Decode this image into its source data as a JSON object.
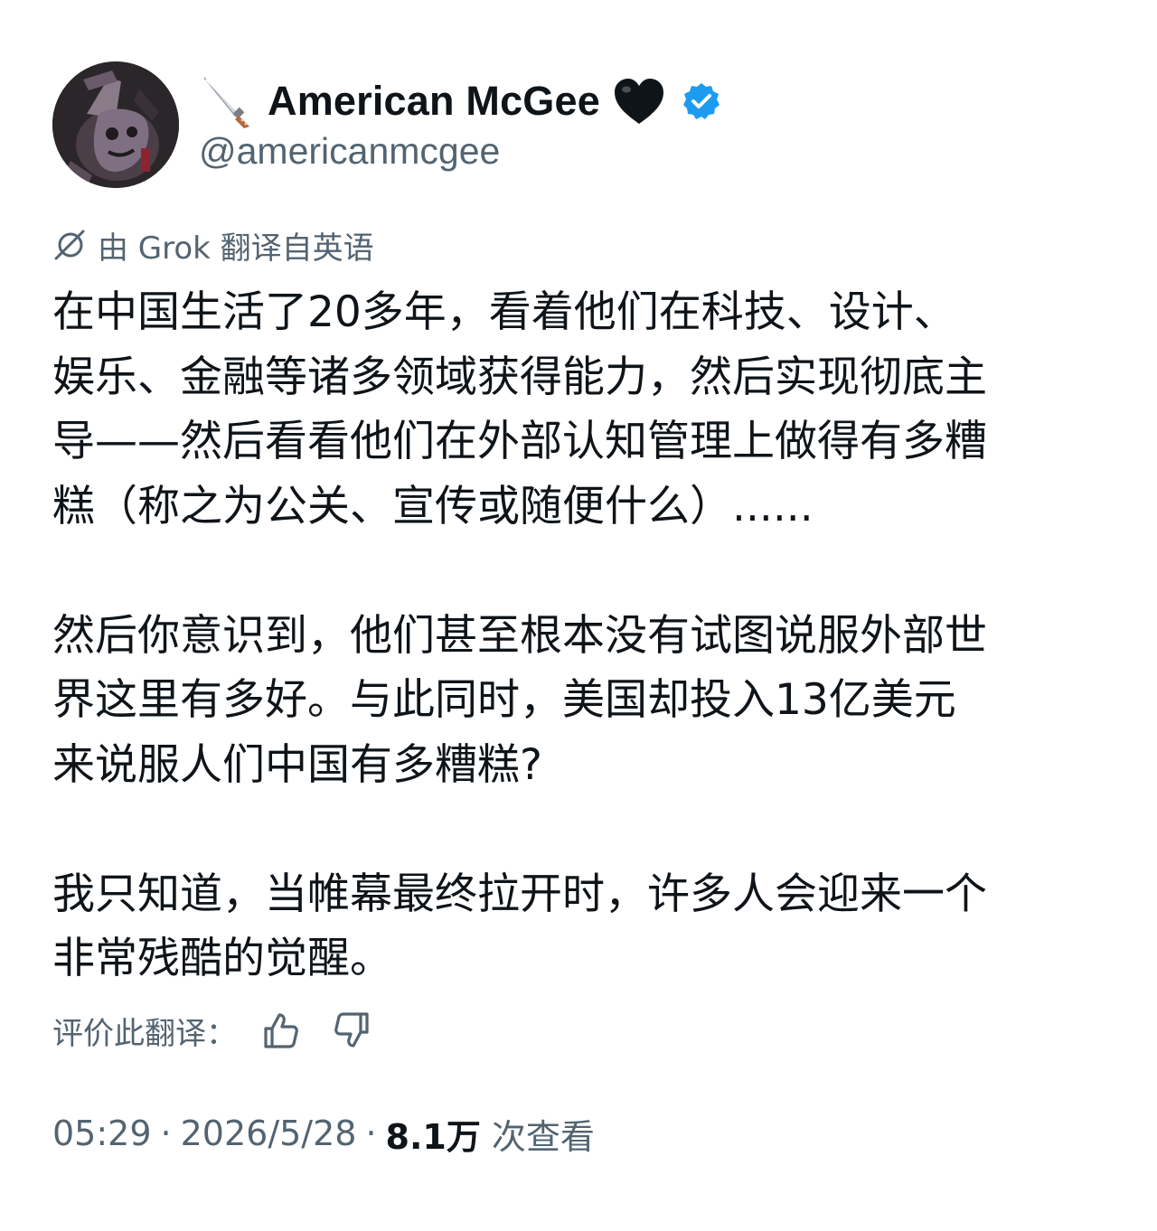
{
  "author": {
    "display_name": "American McGee",
    "handle": "@americanmcgee",
    "prefix_emoji": "knife-emoji",
    "suffix_emoji": "black-heart-emoji",
    "verified": true,
    "verified_color": "#1d9bf0"
  },
  "translation": {
    "notice": "由 Grok 翻译自英语",
    "icon": "translate-slash-icon"
  },
  "tweet": {
    "paragraphs": [
      [
        "在中国生活了20多年，看着他们在科技、设计、",
        "娱乐、金融等诸多领域获得能力，然后实现彻底主",
        "导——然后看看他们在外部认知管理上做得有多糟",
        "糕（称之为公关、宣传或随便什么）......"
      ],
      [
        "然后你意识到，他们甚至根本没有试图说服外部世",
        "界这里有多好。与此同时，美国却投入13亿美元",
        "来说服人们中国有多糟糕?"
      ],
      [
        "我只知道，当帷幕最终拉开时，许多人会迎来一个",
        "非常残酷的觉醒。"
      ]
    ]
  },
  "rating": {
    "label": "评价此翻译：",
    "up_icon": "thumbs-up-icon",
    "down_icon": "thumbs-down-icon"
  },
  "meta": {
    "time": "05:29",
    "separator": "·",
    "date": "2026/5/28",
    "views_count": "8.1万",
    "views_label": "次查看"
  },
  "colors": {
    "text_primary": "#0f1419",
    "text_secondary": "#536471",
    "background": "#ffffff"
  }
}
